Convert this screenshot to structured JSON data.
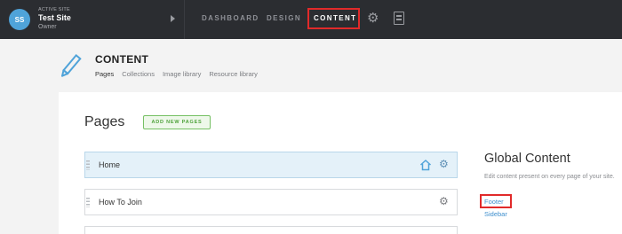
{
  "topbar": {
    "avatar_initials": "SS",
    "active_site_label": "ACTIVE SITE",
    "site_name": "Test Site",
    "site_role": "Owner",
    "nav": {
      "dashboard": "DASHBOARD",
      "design": "DESIGN",
      "content": "CONTENT"
    },
    "icons": [
      "caret-right-icon",
      "gear-icon",
      "document-icon"
    ],
    "colors": {
      "bar_bg": "#2b2d31",
      "avatar_bg": "#4fa3d9",
      "highlight": "#e12a2a"
    }
  },
  "header": {
    "title": "CONTENT",
    "tabs": [
      "Pages",
      "Collections",
      "Image library",
      "Resource library"
    ],
    "active_tab": "Pages",
    "icon": "pencil-icon"
  },
  "pages_section": {
    "title": "Pages",
    "add_button": "ADD NEW PAGES",
    "rows": [
      {
        "label": "Home",
        "is_home": true
      },
      {
        "label": "How To Join",
        "is_home": false
      },
      {
        "label": "",
        "is_home": false
      }
    ]
  },
  "global_content": {
    "title": "Global Content",
    "description": "Edit content present on every page of your site.",
    "links": [
      "Footer",
      "Sidebar"
    ]
  }
}
